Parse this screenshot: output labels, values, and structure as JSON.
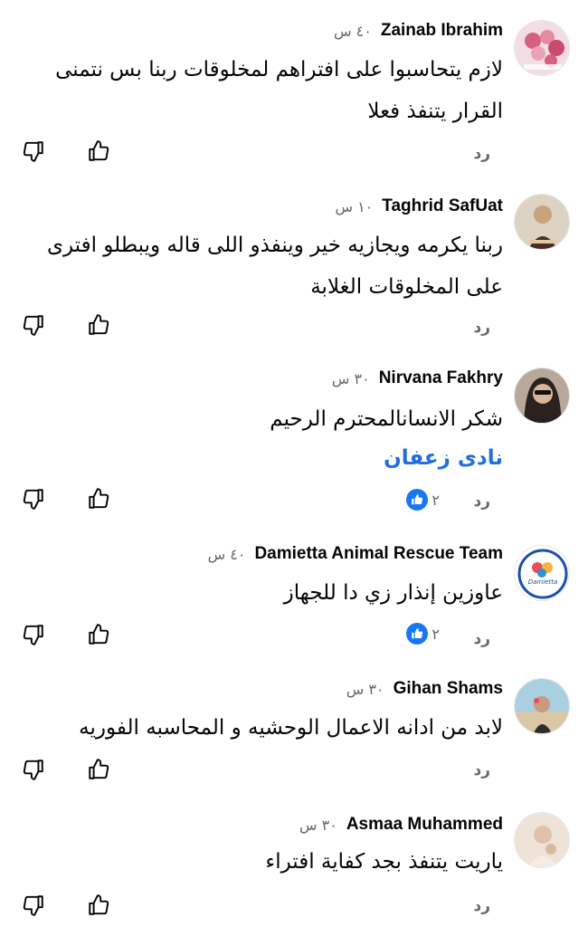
{
  "comments": [
    {
      "author": "Zainab Ibrahim",
      "time": "٤٠ س",
      "text": "لازم يتحاسبوا على افتراهم لمخلوقات ربنا بس نتمنى القرار يتنفذ فعلا",
      "reply": "رد",
      "avatar_color": "#d9a3b3"
    },
    {
      "author": "Taghrid SafUat",
      "time": "١٠ س",
      "text": "ربنا يكرمه ويجازيه خير وينفذو اللى قاله ويبطلو افترى على المخلوقات الغلابة",
      "reply": "رد",
      "avatar_color": "#c9b9a0"
    },
    {
      "author": "Nirvana Fakhry",
      "time": "٣٠ س",
      "text": "شكر الانسانالمحترم الرحيم",
      "mention": "نادى زعفان",
      "reply": "رد",
      "reactions": "٢",
      "avatar_color": "#7a6a60"
    },
    {
      "author": "Damietta Animal Rescue Team",
      "time": "٤٠ س",
      "text": "عاوزين إنذار زي دا للجهاز",
      "reply": "رد",
      "reactions": "٢",
      "avatar_label": "Damietta",
      "avatar_color": "#1f4fa8"
    },
    {
      "author": "Gihan Shams",
      "time": "٣٠ س",
      "text": "لابد من ادانه الاعمال الوحشيه و المحاسبه الفوريه",
      "reply": "رد",
      "avatar_color": "#8fb8c9"
    },
    {
      "author": "Asmaa Muhammed",
      "time": "٣٠ س",
      "text": "ياريت يتنفذ بجد كفاية افتراء",
      "reply": "رد",
      "avatar_color": "#e8d3c4"
    }
  ],
  "colors": {
    "accent": "#1877f2",
    "mention": "#216fdb",
    "secondary_text": "#65676b"
  }
}
